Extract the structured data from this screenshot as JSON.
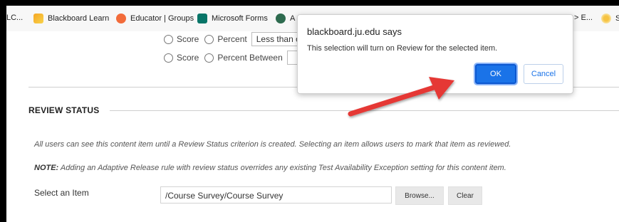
{
  "bookmarks": {
    "items": [
      {
        "label": "LC...",
        "icon": "none"
      },
      {
        "label": "Blackboard Learn",
        "icon": "blackboard-icon"
      },
      {
        "label": "Educator | Groups",
        "icon": "educator-icon"
      },
      {
        "label": "Microsoft Forms",
        "icon": "forms-icon"
      },
      {
        "label": "A",
        "icon": "globe-icon"
      },
      {
        "label": "> E...",
        "icon": "none"
      },
      {
        "label": "S",
        "icon": "sun-icon"
      }
    ]
  },
  "criteria": {
    "row1": {
      "score": "Score",
      "percent": "Percent",
      "select": "Less than or"
    },
    "row2": {
      "score": "Score",
      "percent": "Percent Between"
    }
  },
  "review_status": {
    "title": "REVIEW STATUS",
    "info": "All users can see this content item until a Review Status criterion is created. Selecting an item allows users to mark that item as reviewed.",
    "note_label": "NOTE:",
    "note_text": " Adding an Adaptive Release rule with review status overrides any existing Test Availability Exception setting for this content item.",
    "select_label": "Select an Item",
    "path_value": "/Course Survey/Course Survey",
    "browse_label": "Browse...",
    "clear_label": "Clear"
  },
  "dialog": {
    "title": "blackboard.ju.edu says",
    "message": "This selection will turn on Review for the selected item.",
    "ok_label": "OK",
    "cancel_label": "Cancel"
  },
  "colors": {
    "ok_blue": "#1a73e8",
    "arrow_red": "#e53935"
  }
}
